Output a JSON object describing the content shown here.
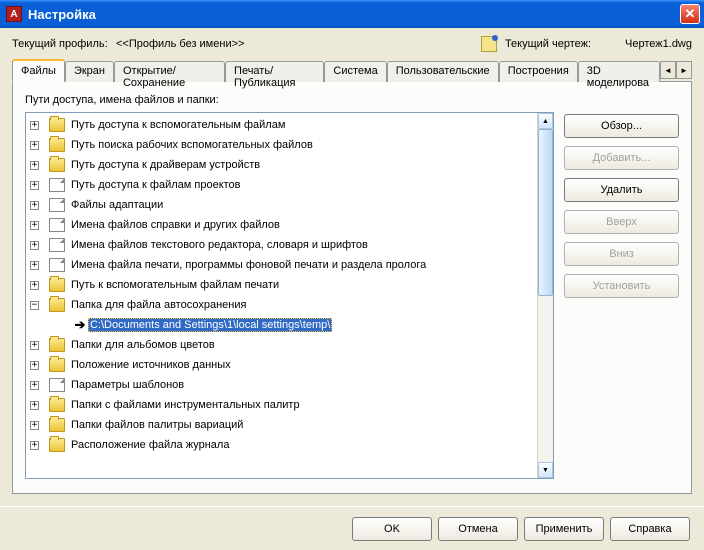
{
  "window": {
    "title": "Настройка",
    "close": "✕"
  },
  "profile_row": {
    "label": "Текущий профиль:",
    "value": "<<Профиль без имени>>",
    "drawing_label": "Текущий чертеж:",
    "drawing_value": "Чертеж1.dwg"
  },
  "tabs": [
    "Файлы",
    "Экран",
    "Открытие/Сохранение",
    "Печать/Публикация",
    "Система",
    "Пользовательские",
    "Построения",
    "3D моделирова"
  ],
  "active_tab": 0,
  "panel_title": "Пути доступа, имена файлов и папки:",
  "tree": [
    {
      "kind": "folder",
      "exp": "+",
      "label": "Путь доступа к вспомогательным файлам"
    },
    {
      "kind": "folder",
      "exp": "+",
      "label": "Путь поиска рабочих вспомогательных файлов"
    },
    {
      "kind": "folder",
      "exp": "+",
      "label": "Путь доступа к драйверам устройств"
    },
    {
      "kind": "file",
      "exp": "+",
      "label": "Путь доступа к файлам проектов"
    },
    {
      "kind": "file",
      "exp": "+",
      "label": "Файлы адаптации"
    },
    {
      "kind": "file",
      "exp": "+",
      "label": "Имена файлов справки и других файлов"
    },
    {
      "kind": "file",
      "exp": "+",
      "label": "Имена файлов текстового редактора, словаря и шрифтов"
    },
    {
      "kind": "file",
      "exp": "+",
      "label": "Имена файла печати, программы фоновой печати и раздела пролога"
    },
    {
      "kind": "folder",
      "exp": "+",
      "label": "Путь к вспомогательным файлам печати"
    },
    {
      "kind": "folder",
      "exp": "-",
      "label": "Папка для файла автосохранения"
    },
    {
      "kind": "child",
      "label": "C:\\Documents and Settings\\1\\local settings\\temp\\",
      "selected": true
    },
    {
      "kind": "folder",
      "exp": "+",
      "label": "Папки для альбомов цветов"
    },
    {
      "kind": "folder",
      "exp": "+",
      "label": "Положение источников данных"
    },
    {
      "kind": "file",
      "exp": "+",
      "label": "Параметры шаблонов"
    },
    {
      "kind": "folder",
      "exp": "+",
      "label": "Папки с файлами инструментальных палитр"
    },
    {
      "kind": "folder",
      "exp": "+",
      "label": "Папки файлов палитры вариаций"
    },
    {
      "kind": "folder",
      "exp": "+",
      "label": "Расположение файла журнала"
    }
  ],
  "side_buttons": [
    {
      "label": "Обзор...",
      "enabled": true
    },
    {
      "label": "Добавить...",
      "enabled": false
    },
    {
      "label": "Удалить",
      "enabled": true
    },
    {
      "label": "Вверх",
      "enabled": false
    },
    {
      "label": "Вниз",
      "enabled": false
    },
    {
      "label": "Установить",
      "enabled": false
    }
  ],
  "bottom_buttons": [
    "OK",
    "Отмена",
    "Применить",
    "Справка"
  ]
}
